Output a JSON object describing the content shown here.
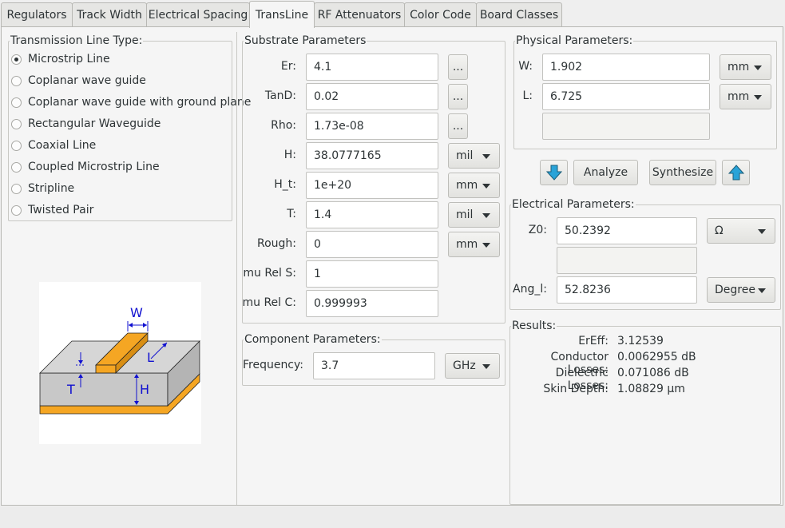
{
  "tabs": [
    "Regulators",
    "Track Width",
    "Electrical Spacing",
    "TransLine",
    "RF Attenuators",
    "Color Code",
    "Board Classes"
  ],
  "line_type": {
    "title": "Transmission Line Type:",
    "options": [
      "Microstrip Line",
      "Coplanar wave guide",
      "Coplanar wave guide with ground plane",
      "Rectangular Waveguide",
      "Coaxial Line",
      "Coupled Microstrip Line",
      "Stripline",
      "Twisted Pair"
    ],
    "selected": "Microstrip Line"
  },
  "diagram": {
    "w": "W",
    "l": "L",
    "t": "T",
    "h": "H"
  },
  "substrate": {
    "title": "Substrate Parameters",
    "er": {
      "label": "Er:",
      "value": "4.1",
      "btn": "..."
    },
    "tand": {
      "label": "TanD:",
      "value": "0.02",
      "btn": "..."
    },
    "rho": {
      "label": "Rho:",
      "value": "1.73e-08",
      "btn": "..."
    },
    "h": {
      "label": "H:",
      "value": "38.0777165",
      "unit": "mil"
    },
    "ht": {
      "label": "H_t:",
      "value": "1e+20",
      "unit": "mm"
    },
    "t": {
      "label": "T:",
      "value": "1.4",
      "unit": "mil"
    },
    "rough": {
      "label": "Rough:",
      "value": "0",
      "unit": "mm"
    },
    "murels": {
      "label": "mu Rel S:",
      "value": "1"
    },
    "murelc": {
      "label": "mu Rel C:",
      "value": "0.999993"
    }
  },
  "component": {
    "title": "Component Parameters:",
    "freq": {
      "label": "Frequency:",
      "value": "3.7",
      "unit": "GHz"
    }
  },
  "physical": {
    "title": "Physical Parameters:",
    "w": {
      "label": "W:",
      "value": "1.902",
      "unit": "mm"
    },
    "l": {
      "label": "L:",
      "value": "6.725",
      "unit": "mm"
    },
    "extra": ""
  },
  "actions": {
    "analyze": "Analyze",
    "synthesize": "Synthesize"
  },
  "electrical": {
    "title": "Electrical Parameters:",
    "z0": {
      "label": "Z0:",
      "value": "50.2392",
      "unit": "Ω"
    },
    "extra": "",
    "angl": {
      "label": "Ang_l:",
      "value": "52.8236",
      "unit": "Degree"
    }
  },
  "results": {
    "title": "Results:",
    "rows": [
      {
        "label": "ErEff:",
        "value": "3.12539"
      },
      {
        "label": "Conductor Losses:",
        "value": "0.0062955 dB"
      },
      {
        "label": "Dielectric Losses:",
        "value": "0.071086 dB"
      },
      {
        "label": "Skin Depth:",
        "value": "1.08829 µm"
      }
    ]
  },
  "colors": {
    "copper": "#f5a623",
    "substrate": "#c8c8c8",
    "arrow_accent": "#29a3d8",
    "dimension": "#1010d0"
  }
}
